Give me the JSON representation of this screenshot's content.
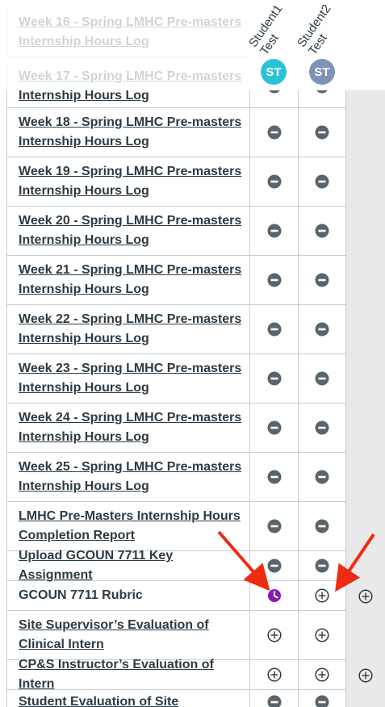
{
  "students": [
    {
      "name": "Student1\nTest",
      "initials": "ST"
    },
    {
      "name": "Student2\nTest",
      "initials": "ST"
    }
  ],
  "assignments": [
    {
      "title": "Week 16 - Spring LMHC Pre-masters Internship Hours Log",
      "s1": "minus-icon",
      "s2": "minus-icon",
      "extra": ""
    },
    {
      "title": "Week 17 - Spring LMHC Pre-masters Internship Hours Log",
      "s1": "minus-icon",
      "s2": "minus-icon",
      "extra": ""
    },
    {
      "title": "Week 18 - Spring LMHC Pre-masters Internship Hours Log",
      "s1": "minus-icon",
      "s2": "minus-icon",
      "extra": ""
    },
    {
      "title": "Week 19 - Spring LMHC Pre-masters Internship Hours Log",
      "s1": "minus-icon",
      "s2": "minus-icon",
      "extra": ""
    },
    {
      "title": "Week 20 - Spring LMHC Pre-masters Internship Hours Log",
      "s1": "minus-icon",
      "s2": "minus-icon",
      "extra": ""
    },
    {
      "title": "Week 21 - Spring LMHC Pre-masters Internship Hours Log",
      "s1": "minus-icon",
      "s2": "minus-icon",
      "extra": ""
    },
    {
      "title": "Week 22 - Spring LMHC Pre-masters Internship Hours Log",
      "s1": "minus-icon",
      "s2": "minus-icon",
      "extra": ""
    },
    {
      "title": "Week 23 - Spring LMHC Pre-masters Internship Hours Log",
      "s1": "minus-icon",
      "s2": "minus-icon",
      "extra": ""
    },
    {
      "title": "Week 24 - Spring LMHC Pre-masters Internship Hours Log",
      "s1": "minus-icon",
      "s2": "minus-icon",
      "extra": ""
    },
    {
      "title": "Week 25 - Spring LMHC Pre-masters Internship Hours Log",
      "s1": "minus-icon",
      "s2": "minus-icon",
      "extra": ""
    },
    {
      "title": "LMHC Pre-Masters Internship Hours Completion Report",
      "s1": "minus-icon",
      "s2": "minus-icon",
      "extra": ""
    },
    {
      "title": "Upload GCOUN 7711 Key Assignment",
      "s1": "minus-icon",
      "s2": "minus-icon",
      "extra": ""
    },
    {
      "title": "GCOUN 7711 Rubric",
      "s1": "clock-icon",
      "s2": "plus-circle-icon",
      "extra": "plus-circle-icon",
      "style": "plain"
    },
    {
      "title": "Site Supervisor’s Evaluation of Clinical Intern",
      "s1": "plus-circle-icon",
      "s2": "plus-circle-icon",
      "extra": ""
    },
    {
      "title": "CP&S Instructor’s Evaluation of Intern",
      "s1": "plus-circle-icon",
      "s2": "plus-circle-icon",
      "extra": "plus-circle-icon"
    },
    {
      "title": "Student Evaluation of Site",
      "s1": "minus-icon",
      "s2": "minus-icon",
      "extra": ""
    }
  ],
  "colors": {
    "icon": "#5a646b",
    "clock": "#8b1ab0",
    "arrow": "#ee2b13"
  }
}
